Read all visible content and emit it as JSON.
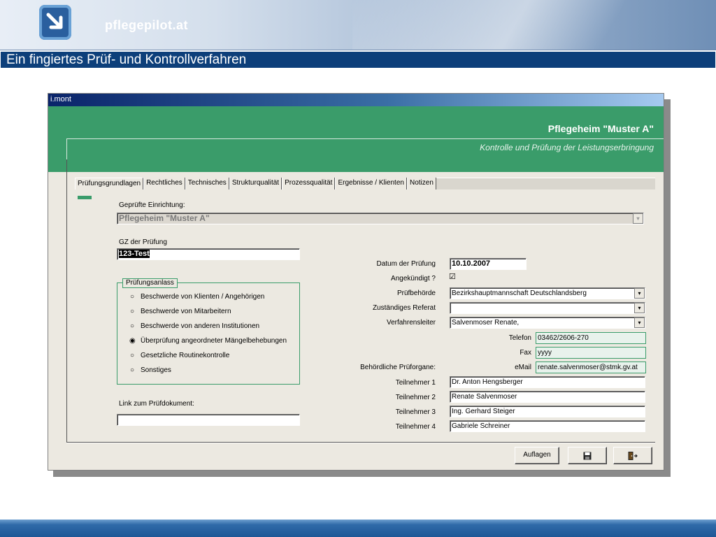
{
  "slide": {
    "site_name": "pflegepilot.at",
    "title": "Ein fingiertes Prüf- und Kontrollverfahren"
  },
  "app": {
    "window_title": "i.mont",
    "facility_title": "Pflegeheim \"Muster A\"",
    "subtitle": "Kontrolle und Prüfung der Leistungserbringung",
    "tabs": [
      "Prüfungsgrundlagen",
      "Rechtliches",
      "Technisches",
      "Strukturqualität",
      "Prozessqualität",
      "Ergebnisse / Klienten",
      "Notizen"
    ],
    "active_tab": "Prüfungsgrundlagen"
  },
  "form": {
    "einrichtung_label": "Geprüfte Einrichtung:",
    "einrichtung_value": "Pflegeheim \"Muster A\"",
    "gz_label": "GZ der Prüfung",
    "gz_value": "123-Test",
    "anlass_legend": "Prüfungsanlass",
    "anlass_options": [
      {
        "label": "Beschwerde von Klienten / Angehörigen",
        "mark": "○"
      },
      {
        "label": "Beschwerde von Mitarbeitern",
        "mark": "○"
      },
      {
        "label": "Beschwerde von anderen Institutionen",
        "mark": "○"
      },
      {
        "label": "Überprüfung angeordneter Mängelbehebungen",
        "mark": "◉"
      },
      {
        "label": "Gesetzliche Routinekontrolle",
        "mark": "○"
      },
      {
        "label": "Sonstiges",
        "mark": "○"
      }
    ],
    "link_label": "Link zum Prüfdokument:",
    "link_value": "",
    "datum_label": "Datum der Prüfung",
    "datum_value": "10.10.2007",
    "angekuendigt_label": "Angekündigt ?",
    "angekuendigt_mark": "☑",
    "pruefbehoerde_label": "Prüfbehörde",
    "pruefbehoerde_value": "Bezirkshauptmannschaft Deutschlandsberg",
    "referat_label": "Zuständiges Referat",
    "referat_value": "",
    "verfahrensleiter_label": "Verfahrensleiter",
    "verfahrensleiter_value": "Salvenmoser Renate,",
    "telefon_label": "Telefon",
    "telefon_value": "03462/2606-270",
    "fax_label": "Fax",
    "fax_value": "yyyy",
    "email_label": "eMail",
    "email_value": "renate.salvenmoser@stmk.gv.at",
    "organe_label": "Behördliche Prüforgane:",
    "teilnehmer": [
      {
        "label": "Teilnehmer 1",
        "value": "Dr. Anton Hengsberger"
      },
      {
        "label": "Teilnehmer 2",
        "value": "Renate Salvenmoser"
      },
      {
        "label": "Teilnehmer 3",
        "value": "Ing. Gerhard Steiger"
      },
      {
        "label": "Teilnehmer 4",
        "value": "Gabriele Schreiner"
      }
    ]
  },
  "buttons": {
    "auflagen": "Auflagen",
    "save_icon": "floppy-disk-icon",
    "exit_icon": "exit-door-icon"
  },
  "colors": {
    "green": "#3a9c6a",
    "title_bar": "#0d3f7a"
  }
}
